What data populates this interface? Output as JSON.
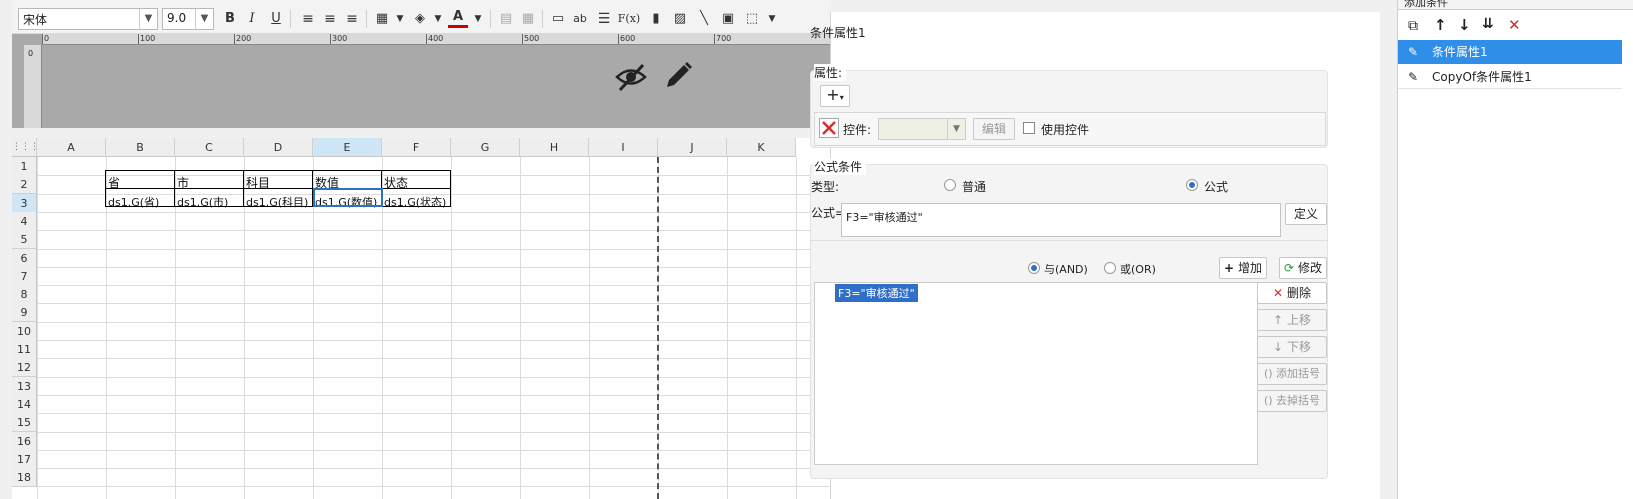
{
  "toolbar": {
    "font_name": "宋体",
    "font_size": "9.0",
    "bold": "B",
    "italic": "I",
    "underline": "U",
    "text_color_label": "A",
    "ab_label": "ab",
    "fx_label": "F(x)"
  },
  "ruler": {
    "ticks": [
      "0",
      "100",
      "200",
      "300",
      "400",
      "500",
      "600",
      "700"
    ],
    "v_zero": "0"
  },
  "grid": {
    "columns": [
      "A",
      "B",
      "C",
      "D",
      "E",
      "F",
      "G",
      "H",
      "I",
      "J",
      "K"
    ],
    "rows": [
      "1",
      "2",
      "3",
      "4",
      "5",
      "6",
      "7",
      "8",
      "9",
      "10",
      "11",
      "12",
      "13",
      "14",
      "15",
      "16",
      "17",
      "18"
    ],
    "header_row": [
      "省",
      "市",
      "科目",
      "数值",
      "状态"
    ],
    "data_row": [
      "ds1.G(省)",
      "ds1.G(市)",
      "ds1.G(科目)",
      "ds1.G(数值)",
      "ds1.G(状态)"
    ]
  },
  "condition_panel": {
    "title": "条件属性1",
    "attr_section_label": "属性:",
    "add_label": "+",
    "control_label": "控件:",
    "edit_label": "编辑",
    "use_control_label": "使用控件",
    "formula_section_label": "公式条件",
    "type_label": "类型:",
    "type_normal": "普通",
    "type_formula": "公式",
    "formula_label": "公式=",
    "formula_value": "F3=\"审核通过\"",
    "define_label": "定义",
    "and_label": "与(AND)",
    "or_label": "或(OR)",
    "add_btn": "增加",
    "modify_btn": "修改",
    "conditions": [
      "F3=\"审核通过\""
    ],
    "delete_btn": "删除",
    "up_btn": "上移",
    "down_btn": "下移",
    "add_bracket_btn": "添加括号",
    "remove_bracket_btn": "去掉括号"
  },
  "list_panel": {
    "header": "添加条件",
    "items": [
      "条件属性1",
      "CopyOf条件属性1"
    ]
  },
  "colors": {
    "selected": "#2f8ee8",
    "formula_highlight": "#2f6fc8",
    "delete_red": "#d62d2d"
  }
}
